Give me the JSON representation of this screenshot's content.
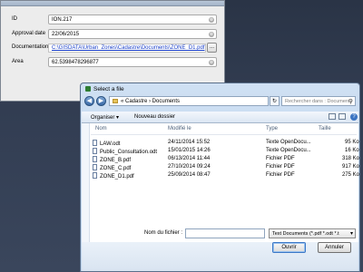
{
  "form": {
    "fields": [
      {
        "label": "ID",
        "value": "ION.217",
        "kind": "text"
      },
      {
        "label": "Approval date",
        "value": "22/06/2015",
        "kind": "text"
      },
      {
        "label": "Documentation",
        "value": "C:\\GISDATA\\Urban_Zones\\Cadastre\\Documents\\ZONE_D1.pdf",
        "kind": "link"
      },
      {
        "label": "Area",
        "value": "62.5398478296877",
        "kind": "text"
      }
    ],
    "browse_label": "...",
    "clear_glyph": "⊗"
  },
  "file_dialog": {
    "title": "Select a file",
    "path": "« Cadastre › Documents",
    "search_placeholder": "Rechercher dans : Documents",
    "organize_label": "Organiser ▾",
    "new_folder_label": "Nouveau dossier",
    "columns": [
      "Nom",
      "Modifié le",
      "Type",
      "Taille"
    ],
    "files": [
      {
        "name": "LAW.odt",
        "modified": "24/11/2014 15:52",
        "type": "Texte OpenDocu...",
        "size": "95 Ko"
      },
      {
        "name": "Public_Consultation.odt",
        "modified": "15/01/2015 14:26",
        "type": "Texte OpenDocu...",
        "size": "16 Ko"
      },
      {
        "name": "ZONE_B.pdf",
        "modified": "06/13/2014 11:44",
        "type": "Fichier PDF",
        "size": "318 Ko"
      },
      {
        "name": "ZONE_C.pdf",
        "modified": "27/10/2014 09:24",
        "type": "Fichier PDF",
        "size": "917 Ko"
      },
      {
        "name": "ZONE_D1.pdf",
        "modified": "25/09/2014 08:47",
        "type": "Fichier PDF",
        "size": "275 Ko"
      }
    ],
    "filename_label": "Nom du fichier :",
    "filename_value": "",
    "filetype_value": "Text Documents (*.pdf *.odt *.t",
    "open_label": "Ouvrir",
    "cancel_label": "Annuler"
  },
  "icons": {
    "back": "◀",
    "forward": "▶",
    "refresh": "↻",
    "search": "⚲",
    "dropdown": "▾",
    "help": "?"
  }
}
